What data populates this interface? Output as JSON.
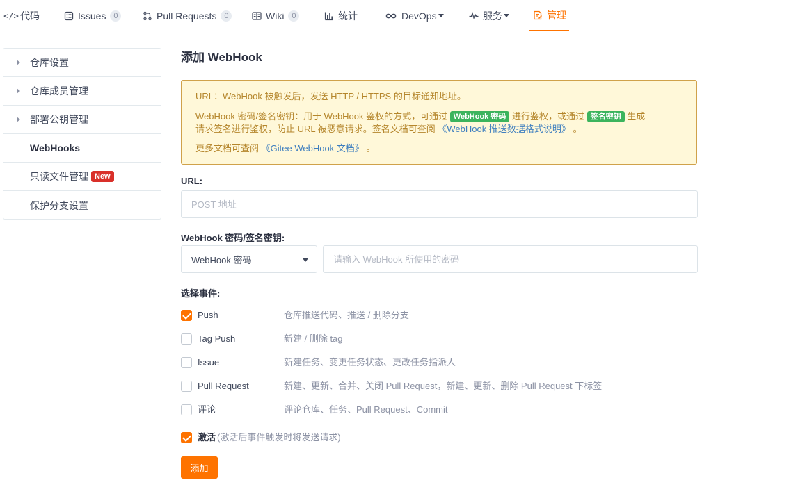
{
  "nav": {
    "tabs": [
      {
        "label": "代码",
        "icon": "</>"
      },
      {
        "label": "Issues",
        "count": "0"
      },
      {
        "label": "Pull Requests",
        "count": "0"
      },
      {
        "label": "Wiki",
        "count": "0"
      },
      {
        "label": "统计"
      },
      {
        "label": "DevOps"
      },
      {
        "label": "服务"
      },
      {
        "label": "管理"
      }
    ],
    "active_color": "#fe7300"
  },
  "sidebar": {
    "items": [
      {
        "label": "仓库设置"
      },
      {
        "label": "仓库成员管理"
      },
      {
        "label": "部署公钥管理"
      },
      {
        "label": "WebHooks"
      },
      {
        "label": "只读文件管理",
        "badge": "New"
      },
      {
        "label": "保护分支设置"
      }
    ]
  },
  "main": {
    "title": "添加 WebHook",
    "notice": {
      "line1": "URL：WebHook 被触发后，发送 HTTP / HTTPS 的目标通知地址。",
      "line2_a": "WebHook 密码/签名密钥：用于 WebHook 鉴权的方式，可通过",
      "tag1": "WebHook 密码",
      "line2_b": "进行鉴权，或通过",
      "tag2": "签名密钥",
      "line2_c": "生成",
      "line3_a": "请求签名进行鉴权，防止 URL 被恶意请求。签名文档可查阅",
      "line3_link": "《WebHook 推送数据格式说明》",
      "line3_b": "。",
      "line4_a": "更多文档可查阅",
      "line4_link": "《Gitee WebHook 文档》",
      "line4_b": "。"
    },
    "url_label": "URL:",
    "url_placeholder": "POST 地址",
    "secret_label": "WebHook 密码/签名密钥:",
    "secret_type": "WebHook 密码",
    "secret_placeholder": "请输入 WebHook 所使用的密码",
    "events_label": "选择事件:",
    "events": [
      {
        "name": "Push",
        "desc": "仓库推送代码、推送 / 删除分支",
        "checked": true
      },
      {
        "name": "Tag Push",
        "desc": "新建 / 删除 tag",
        "checked": false
      },
      {
        "name": "Issue",
        "desc": "新建任务、变更任务状态、更改任务指派人",
        "checked": false
      },
      {
        "name": "Pull Request",
        "desc": "新建、更新、合并、关闭 Pull Request，新建、更新、删除 Pull Request 下标签",
        "checked": false
      },
      {
        "name": "评论",
        "desc": "评论仓库、任务、Pull Request、Commit",
        "checked": false
      }
    ],
    "activate_label": "激活",
    "activate_note": "(激活后事件触发时将发送请求)",
    "activate_checked": true,
    "submit_label": "添加"
  }
}
